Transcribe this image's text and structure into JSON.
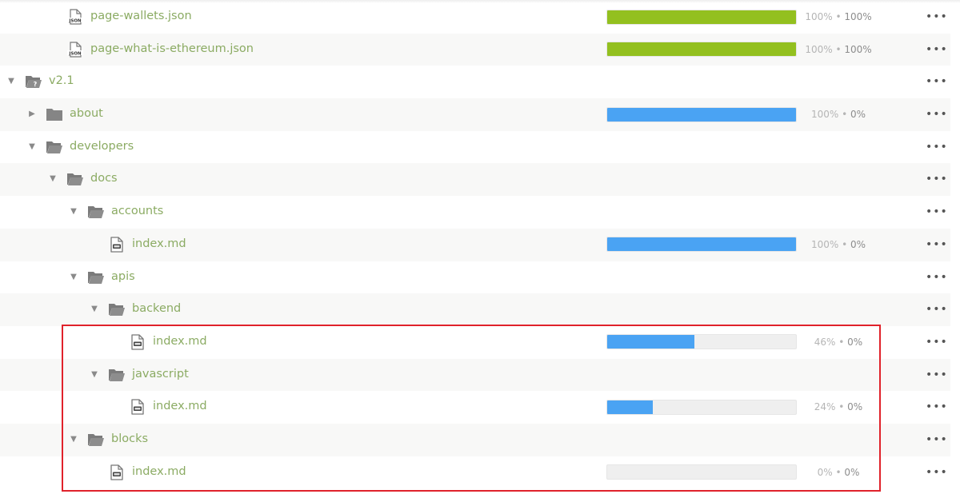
{
  "rows": [
    {
      "type": "file",
      "kind": "json",
      "name": "page-wallets.json",
      "depth": 2,
      "translated": "100%",
      "approved": "100%",
      "progress": 1.0,
      "color": "green"
    },
    {
      "type": "file",
      "kind": "json",
      "name": "page-what-is-ethereum.json",
      "depth": 2,
      "translated": "100%",
      "approved": "100%",
      "progress": 1.0,
      "color": "green"
    },
    {
      "type": "folder",
      "kind": "branch",
      "name": "v2.1",
      "depth": 0,
      "expanded": true
    },
    {
      "type": "folder",
      "kind": "folder",
      "name": "about",
      "depth": 1,
      "expanded": false,
      "translated": "100%",
      "approved": "0%",
      "progress": 1.0,
      "color": "blue"
    },
    {
      "type": "folder",
      "kind": "folder",
      "name": "developers",
      "depth": 1,
      "expanded": true
    },
    {
      "type": "folder",
      "kind": "folder",
      "name": "docs",
      "depth": 2,
      "expanded": true
    },
    {
      "type": "folder",
      "kind": "folder",
      "name": "accounts",
      "depth": 3,
      "expanded": true
    },
    {
      "type": "file",
      "kind": "md",
      "name": "index.md",
      "depth": 4,
      "translated": "100%",
      "approved": "0%",
      "progress": 1.0,
      "color": "blue"
    },
    {
      "type": "folder",
      "kind": "folder",
      "name": "apis",
      "depth": 3,
      "expanded": true
    },
    {
      "type": "folder",
      "kind": "folder",
      "name": "backend",
      "depth": 4,
      "expanded": true
    },
    {
      "type": "file",
      "kind": "md",
      "name": "index.md",
      "depth": 5,
      "translated": "46%",
      "approved": "0%",
      "progress": 0.46,
      "color": "blue"
    },
    {
      "type": "folder",
      "kind": "folder",
      "name": "javascript",
      "depth": 4,
      "expanded": true
    },
    {
      "type": "file",
      "kind": "md",
      "name": "index.md",
      "depth": 5,
      "translated": "24%",
      "approved": "0%",
      "progress": 0.24,
      "color": "blue"
    },
    {
      "type": "folder",
      "kind": "folder",
      "name": "blocks",
      "depth": 3,
      "expanded": true
    },
    {
      "type": "file",
      "kind": "md",
      "name": "index.md",
      "depth": 4,
      "translated": "0%",
      "approved": "0%",
      "progress": 0.0,
      "color": "blue"
    }
  ],
  "icons": {
    "expanded": "▼",
    "collapsed": "▶",
    "more": "•••",
    "separator": " • "
  },
  "colors": {
    "green": "#93c01f",
    "blue": "#4aa3f3",
    "highlight": "#e0222b",
    "name": "#8bab63"
  },
  "annotation": {
    "label": "highlighted-rows"
  }
}
